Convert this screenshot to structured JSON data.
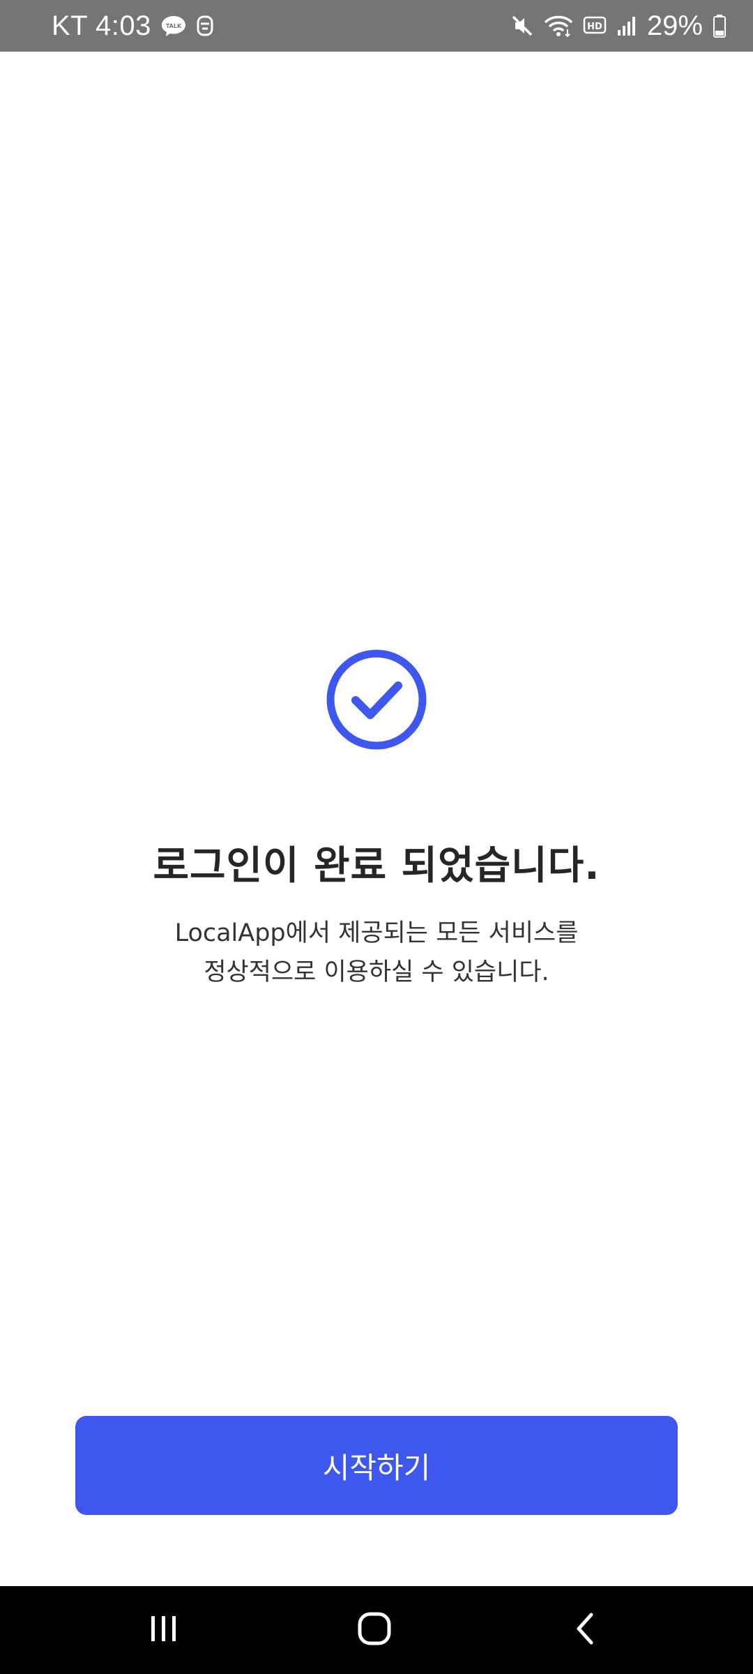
{
  "status_bar": {
    "carrier_time": "KT 4:03",
    "battery": "29%",
    "icons": [
      "kakaotalk-icon",
      "app-notification-icon",
      "mute-icon",
      "wifi-icon",
      "hd-icon",
      "signal-icon",
      "battery-icon"
    ]
  },
  "main": {
    "icon": "check-circle-icon",
    "title": "로그인이 완료 되었습니다.",
    "description_line1": "LocalApp에서 제공되는 모든 서비스를",
    "description_line2": "정상적으로 이용하실 수 있습니다."
  },
  "start_button": {
    "label": "시작하기"
  },
  "nav_bar": {
    "icons": [
      "recents-icon",
      "home-icon",
      "back-icon"
    ]
  },
  "colors": {
    "accent": "#3e57ee",
    "status_bar": "#757575",
    "nav_bar": "#000000",
    "title_text": "#262626"
  }
}
